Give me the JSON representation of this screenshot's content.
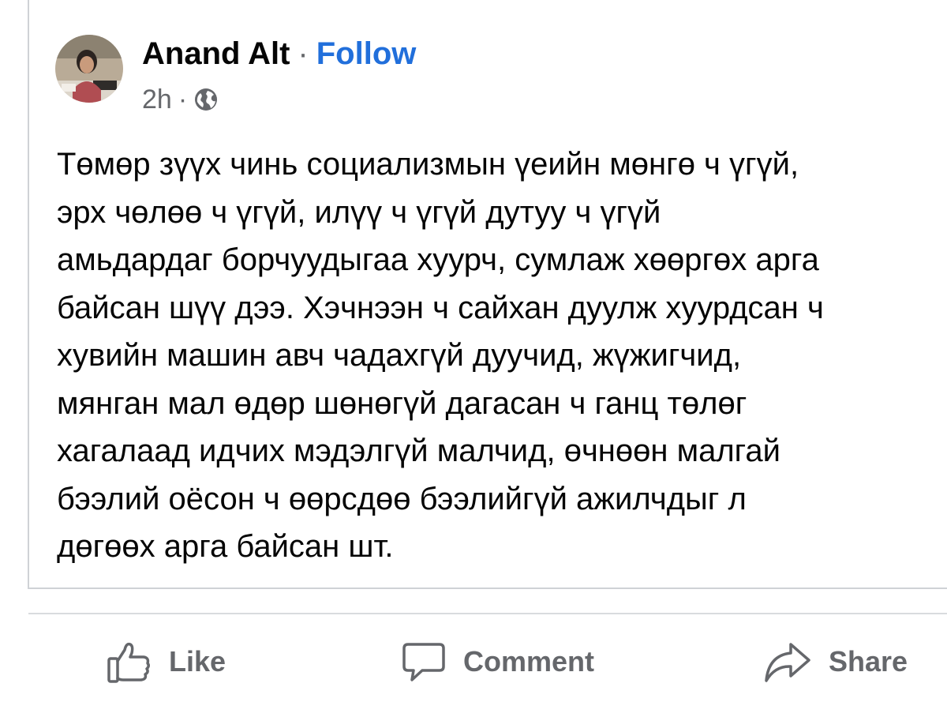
{
  "post": {
    "author": "Anand Alt",
    "separator": "·",
    "follow_label": "Follow",
    "timestamp": "2h",
    "meta_separator": "·",
    "audience_icon": "globe-icon",
    "text_lines": [
      "Төмөр зүүх чинь социализмын үеийн мөнгө ч үгүй,",
      "эрх чөлөө ч үгүй, илүү ч үгүй дутуу ч үгүй",
      "амьдардаг борчуудыгаа хуурч, сумлаж хөөргөх арга",
      "байсан шүү дээ. Хэчнээн ч сайхан дуулж хуурдсан ч",
      "хувийн машин авч чадахгүй дуучид, жүжигчид,",
      "мянган мал өдөр шөнөгүй дагасан ч ганц төлөг",
      "хагалаад идчих мэдэлгүй малчид, өчнөөн малгай",
      "бээлий оёсон ч өөрсдөө бээлийгүй ажилчдыг л",
      "дөгөөх арга байсан шт."
    ]
  },
  "actions": {
    "like_label": "Like",
    "comment_label": "Comment",
    "share_label": "Share"
  },
  "colors": {
    "follow": "#216fdb",
    "secondary_text": "#65676b",
    "primary_text": "#050505",
    "divider": "#d9dbde"
  }
}
